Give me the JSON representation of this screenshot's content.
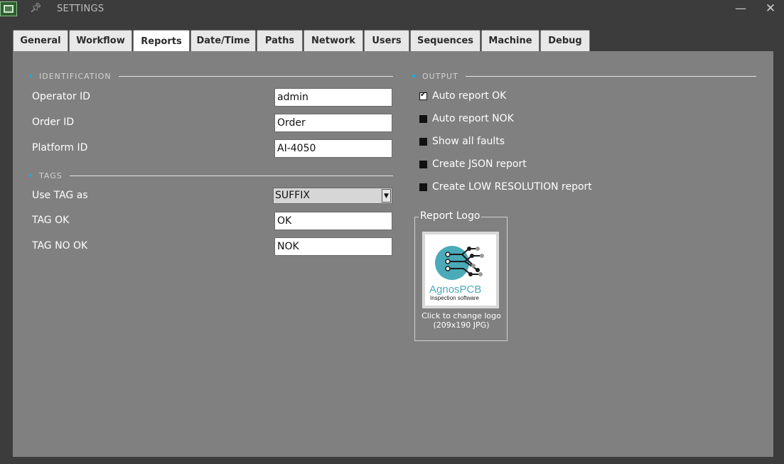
{
  "window": {
    "title": "SETTINGS",
    "minimize_glyph": "—",
    "close_glyph": "✕"
  },
  "tabs": [
    {
      "label": "General"
    },
    {
      "label": "Workflow"
    },
    {
      "label": "Reports",
      "active": true
    },
    {
      "label": "Date/Time"
    },
    {
      "label": "Paths"
    },
    {
      "label": "Network"
    },
    {
      "label": "Users"
    },
    {
      "label": "Sequences"
    },
    {
      "label": "Machine"
    },
    {
      "label": "Debug"
    }
  ],
  "identification": {
    "heading": "IDENTIFICATION",
    "operator_label": "Operator ID",
    "operator_value": "admin",
    "order_label": "Order ID",
    "order_value": "Order",
    "platform_label": "Platform ID",
    "platform_value": "AI-4050"
  },
  "tags": {
    "heading": "TAGS",
    "use_tag_label": "Use TAG as",
    "use_tag_value": "SUFFIX",
    "tag_ok_label": "TAG OK",
    "tag_ok_value": "OK",
    "tag_nok_label": "TAG NO OK",
    "tag_nok_value": "NOK"
  },
  "output": {
    "heading": "OUTPUT",
    "options": [
      {
        "label": "Auto report OK",
        "checked": true
      },
      {
        "label": "Auto report NOK",
        "checked": false
      },
      {
        "label": "Show all faults",
        "checked": false
      },
      {
        "label": "Create JSON report",
        "checked": false
      },
      {
        "label": "Create LOW RESOLUTION report",
        "checked": false
      }
    ]
  },
  "report_logo": {
    "title": "Report Logo",
    "logo_brand": "AgnosPCB",
    "logo_tagline": "Inspection software",
    "caption_line1": "Click to change logo",
    "caption_line2": "(209x190 JPG)"
  },
  "colors": {
    "accent": "#2aa3d6",
    "panel": "#808080",
    "frame": "#3c3c3c",
    "logo_teal": "#4aaab8"
  }
}
